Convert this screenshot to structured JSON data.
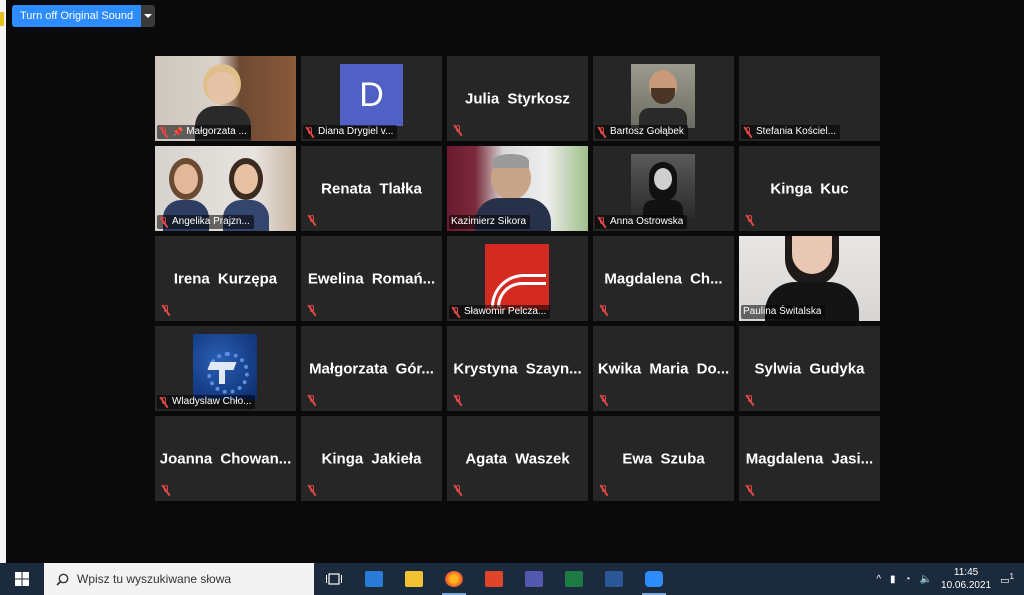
{
  "toolbar": {
    "original_sound_label": "Turn off Original Sound"
  },
  "participants": [
    {
      "name": "Małgorzata ...",
      "pinned": true
    },
    {
      "name": "Diana Drygiel v...",
      "avatar": "D"
    },
    {
      "name": "Julia Styrkosz"
    },
    {
      "name": "Bartosz Gołąbek"
    },
    {
      "name": "Stefania Kościel..."
    },
    {
      "name": "Angelika Prajzn..."
    },
    {
      "name": "Renata Tlałka"
    },
    {
      "name": "Kazimierz Sikora",
      "active_speaker": true
    },
    {
      "name": "Anna Ostrowska"
    },
    {
      "name": "Kinga Kuc"
    },
    {
      "name": "Irena Kurzępa"
    },
    {
      "name": "Ewelina Romań..."
    },
    {
      "name": "Sławomir Pelcza..."
    },
    {
      "name": "Magdalena Ch..."
    },
    {
      "name": "Paulina Świtalska"
    },
    {
      "name": "Wladyslaw Chło..."
    },
    {
      "name": "Małgorzata Gór..."
    },
    {
      "name": "Krystyna Szayn..."
    },
    {
      "name": "Kwika Maria Do..."
    },
    {
      "name": "Sylwia Gudyka"
    },
    {
      "name": "Joanna Chowan..."
    },
    {
      "name": "Kinga Jakieła"
    },
    {
      "name": "Agata Waszek"
    },
    {
      "name": "Ewa Szuba"
    },
    {
      "name": "Magdalena Jasi..."
    }
  ],
  "taskbar": {
    "search_placeholder": "Wpisz tu wyszukiwane słowa",
    "time": "11:45",
    "date": "10.06.2021",
    "notification_count": "1",
    "apps": [
      "task-view",
      "mail",
      "file-explorer",
      "firefox",
      "office",
      "teams",
      "excel",
      "word",
      "zoom"
    ]
  },
  "colors": {
    "accent": "#2d8cff",
    "active_speaker_border": "#e8e87a",
    "avatar_bg": "#5060c4",
    "taskbar": "#1c2a3d",
    "tile_bg": "#262626"
  }
}
